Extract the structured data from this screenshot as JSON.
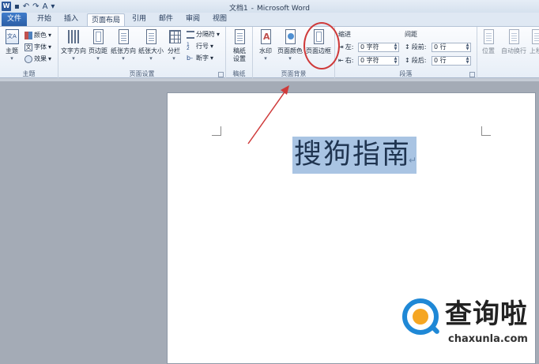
{
  "titlebar": {
    "app_icon": "W",
    "doc_name": "文档1",
    "separator": "-",
    "app_name": "Microsoft Word",
    "qat": [
      "save-icon",
      "undo-icon",
      "redo-icon",
      "font-color-icon",
      "customize-icon"
    ]
  },
  "tabs": [
    "文件",
    "开始",
    "插入",
    "页面布局",
    "引用",
    "邮件",
    "审阅",
    "视图"
  ],
  "ribbon": {
    "theme_group": {
      "label": "主题",
      "theme_button": "主题",
      "colors": "颜色",
      "fonts": "字体",
      "effects": "效果"
    },
    "page_setup": {
      "label": "页面设置",
      "text_direction": "文字方向",
      "margins": "页边距",
      "orientation": "纸张方向",
      "size": "纸张大小",
      "columns": "分栏",
      "breaks": "分隔符",
      "line_numbers": "行号",
      "hyphenation": "断字"
    },
    "draft": {
      "label": "稿纸",
      "button_line1": "稿纸",
      "button_line2": "设置"
    },
    "page_background": {
      "label": "页面背景",
      "watermark": "水印",
      "page_color": "页面颜色",
      "page_borders": "页面边框"
    },
    "paragraph": {
      "label": "段落",
      "indent_title": "缩进",
      "indent_left_label": "左:",
      "indent_left_value": "0 字符",
      "indent_right_label": "右:",
      "indent_right_value": "0 字符",
      "spacing_title": "间距",
      "spacing_before_label": "段前:",
      "spacing_before_value": "0 行",
      "spacing_after_label": "段后:",
      "spacing_after_value": "0 行"
    },
    "arrange": {
      "position": "位置",
      "wrap_text": "自动换行",
      "bring_forward": "上移"
    }
  },
  "document": {
    "text": "搜狗指南",
    "paragraph_mark": "↵"
  },
  "watermark": {
    "brand_cn": "查询啦",
    "brand_en": "chaxunla.com"
  },
  "colors": {
    "annotation": "#cf3a3a",
    "selection": "#a9c4e3",
    "file_tab": "#2c5fa6"
  }
}
